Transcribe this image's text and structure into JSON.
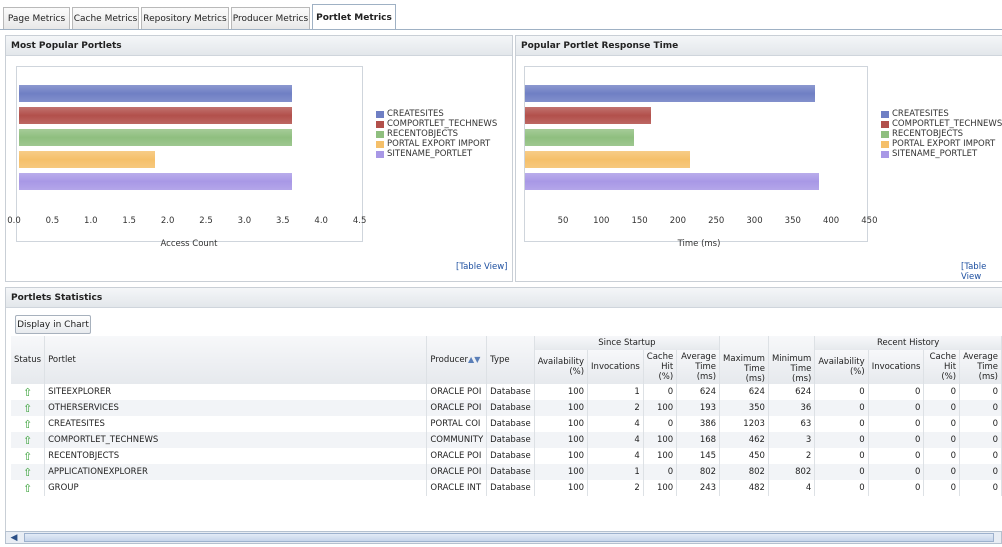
{
  "tabs": [
    {
      "label": "Page Metrics",
      "active": false
    },
    {
      "label": "Cache Metrics",
      "active": false
    },
    {
      "label": "Repository Metrics",
      "active": false
    },
    {
      "label": "Producer Metrics",
      "active": false
    },
    {
      "label": "Portlet Metrics",
      "active": true
    }
  ],
  "popular_panel": {
    "title": "Most Popular Portlets",
    "table_view_link": "[Table View]"
  },
  "response_panel": {
    "title": "Popular Portlet Response Time",
    "table_view_link": "[Table View"
  },
  "statistics_panel": {
    "title": "Portlets Statistics",
    "display_button": "Display in Chart"
  },
  "legend": {
    "items": [
      {
        "label": "CREATESITES",
        "color": "#6f7fc4"
      },
      {
        "label": "COMPORTLET_TECHNEWS",
        "color": "#b2504b"
      },
      {
        "label": "RECENTOBJECTS",
        "color": "#8fbf7f"
      },
      {
        "label": "PORTAL EXPORT IMPORT",
        "color": "#f5c06a"
      },
      {
        "label": "SITENAME_PORTLET",
        "color": "#a898e6"
      }
    ]
  },
  "legend_right": {
    "items": [
      {
        "label": "CREATESITES"
      },
      {
        "label": "COMPORTLET_TECHNEWS"
      },
      {
        "label": "RECENTOBJECTS"
      },
      {
        "label": "PORTAL EXPORT IMPORT"
      },
      {
        "label": "SITENAME_PORTLET"
      }
    ]
  },
  "chart_data": [
    {
      "type": "bar",
      "orientation": "horizontal",
      "title": "Most Popular Portlets",
      "xlabel": "Access Count",
      "ylabel": "",
      "xlim": [
        0,
        4.5
      ],
      "x_ticks": [
        "0.0",
        "0.5",
        "1.0",
        "1.5",
        "2.0",
        "2.5",
        "3.0",
        "3.5",
        "4.0",
        "4.5"
      ],
      "categories": [
        "CREATESITES",
        "COMPORTLET_TECHNEWS",
        "RECENTOBJECTS",
        "PORTAL EXPORT IMPORT",
        "SITENAME_PORTLET"
      ],
      "values": [
        4,
        4,
        4,
        2,
        4
      ],
      "legend_position": "right"
    },
    {
      "type": "bar",
      "orientation": "horizontal",
      "title": "Popular Portlet Response Time",
      "xlabel": "Time (ms)",
      "ylabel": "",
      "xlim": [
        0,
        450
      ],
      "x_ticks": [
        "50",
        "100",
        "150",
        "200",
        "250",
        "300",
        "350",
        "400",
        "450"
      ],
      "categories": [
        "CREATESITES",
        "COMPORTLET_TECHNEWS",
        "RECENTOBJECTS",
        "PORTAL EXPORT IMPORT",
        "SITENAME_PORTLET"
      ],
      "values": [
        386,
        168,
        145,
        220,
        392
      ],
      "legend_position": "right"
    }
  ],
  "table": {
    "headers": {
      "status": "Status",
      "portlet": "Portlet",
      "producer": "Producer",
      "type": "Type",
      "since_startup": "Since Startup",
      "availability": "Availability (%)",
      "invocations": "Invocations",
      "cache_hit": "Cache Hit (%)",
      "average_time": "Average Time (ms)",
      "maximum_time": "Maximum Time (ms)",
      "minimum_time": "Minimum Time (ms)",
      "recent_history": "Recent History",
      "rh_availability": "Availability (%)",
      "rh_invocations": "Invocations",
      "rh_cache_hit": "Cache Hit (%)",
      "rh_average": "Average Time (ms)"
    },
    "rows": [
      {
        "portlet": "SITEEXPLORER",
        "producer": "ORACLE POI",
        "type": "Database",
        "availability": "100",
        "invocations": "1",
        "cache_hit": "0",
        "average": "624",
        "maximum": "624",
        "minimum": "624",
        "rh_availability": "0",
        "rh_invocations": "0",
        "rh_cache_hit": "0",
        "rh_average": "0"
      },
      {
        "portlet": "OTHERSERVICES",
        "producer": "ORACLE POI",
        "type": "Database",
        "availability": "100",
        "invocations": "2",
        "cache_hit": "100",
        "average": "193",
        "maximum": "350",
        "minimum": "36",
        "rh_availability": "0",
        "rh_invocations": "0",
        "rh_cache_hit": "0",
        "rh_average": "0"
      },
      {
        "portlet": "CREATESITES",
        "producer": "PORTAL COI",
        "type": "Database",
        "availability": "100",
        "invocations": "4",
        "cache_hit": "0",
        "average": "386",
        "maximum": "1203",
        "minimum": "63",
        "rh_availability": "0",
        "rh_invocations": "0",
        "rh_cache_hit": "0",
        "rh_average": "0"
      },
      {
        "portlet": "COMPORTLET_TECHNEWS",
        "producer": "COMMUNITY",
        "type": "Database",
        "availability": "100",
        "invocations": "4",
        "cache_hit": "100",
        "average": "168",
        "maximum": "462",
        "minimum": "3",
        "rh_availability": "0",
        "rh_invocations": "0",
        "rh_cache_hit": "0",
        "rh_average": "0"
      },
      {
        "portlet": "RECENTOBJECTS",
        "producer": "ORACLE POI",
        "type": "Database",
        "availability": "100",
        "invocations": "4",
        "cache_hit": "100",
        "average": "145",
        "maximum": "450",
        "minimum": "2",
        "rh_availability": "0",
        "rh_invocations": "0",
        "rh_cache_hit": "0",
        "rh_average": "0"
      },
      {
        "portlet": "APPLICATIONEXPLORER",
        "producer": "ORACLE POI",
        "type": "Database",
        "availability": "100",
        "invocations": "1",
        "cache_hit": "0",
        "average": "802",
        "maximum": "802",
        "minimum": "802",
        "rh_availability": "0",
        "rh_invocations": "0",
        "rh_cache_hit": "0",
        "rh_average": "0"
      },
      {
        "portlet": "GROUP",
        "producer": "ORACLE INT",
        "type": "Database",
        "availability": "100",
        "invocations": "2",
        "cache_hit": "100",
        "average": "243",
        "maximum": "482",
        "minimum": "4",
        "rh_availability": "0",
        "rh_invocations": "0",
        "rh_cache_hit": "0",
        "rh_average": "0"
      }
    ]
  }
}
